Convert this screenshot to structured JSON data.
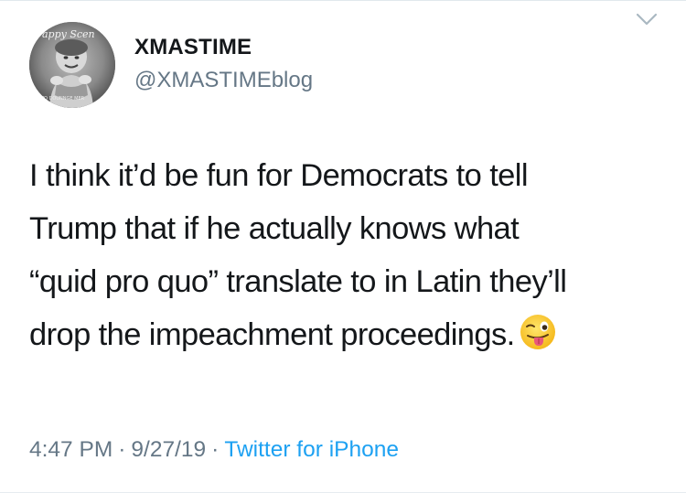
{
  "author": {
    "display_name": "XMASTIME",
    "handle": "@XMASTIMEblog",
    "avatar_caption_top": "appy Scen",
    "avatar_caption_bottom": "TO DOUNNGE MER"
  },
  "tweet": {
    "lines": [
      "I think it’d be fun for Democrats to tell",
      "Trump that if he actually knows what",
      "“quid pro quo” translate to in Latin they’ll",
      "drop the impeachment proceedings."
    ],
    "emoji": "winking-face-with-tongue"
  },
  "meta": {
    "time": "4:47 PM",
    "separator": "·",
    "date": "9/27/19",
    "source": "Twitter for iPhone"
  },
  "colors": {
    "text": "#14171a",
    "secondary": "#657786",
    "link": "#1da1f2",
    "divider": "#e1e8ed"
  },
  "icons": {
    "menu": "chevron-down-icon"
  }
}
